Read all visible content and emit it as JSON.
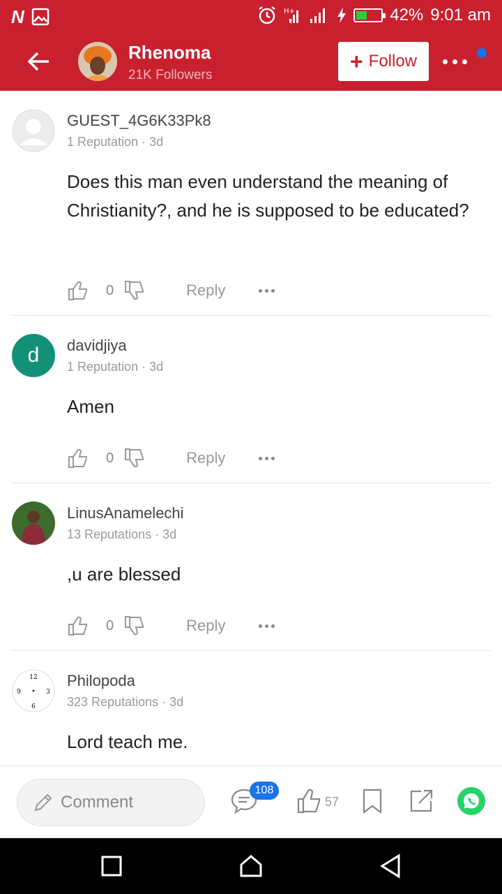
{
  "status_bar": {
    "battery_percent": "42%",
    "battery_level": 0.42,
    "time": "9:01 am",
    "icons": [
      "n-logo-icon",
      "image-icon",
      "alarm-icon",
      "signal-icon",
      "charging-icon",
      "battery-icon"
    ]
  },
  "header": {
    "name": "Rhenoma",
    "followers": "21K Followers",
    "follow_label": "Follow",
    "accent_color": "#c8202f"
  },
  "comments": [
    {
      "username": "GUEST_4G6K33Pk8",
      "meta": "1 Reputation · 3d",
      "text": "Does this man even understand the meaning of Christianity?, and he is supposed to be educated?",
      "likes": "0",
      "reply_label": "Reply",
      "avatar": "default-avatar-icon"
    },
    {
      "username": "davidjiya",
      "meta": "1 Reputation · 3d",
      "text": "Amen",
      "likes": "0",
      "reply_label": "Reply",
      "avatar_letter": "d",
      "avatar_color": "#139078"
    },
    {
      "username": "LinusAnamelechi",
      "meta": "13 Reputations · 3d",
      "text": ",u are blessed",
      "likes": "0",
      "reply_label": "Reply",
      "avatar": "photo-avatar"
    },
    {
      "username": "Philopoda",
      "meta": "323 Reputations · 3d",
      "text": "Lord teach me.",
      "likes": "",
      "reply_label": "",
      "avatar": "clock-avatar"
    }
  ],
  "bottom_bar": {
    "comment_placeholder": "Comment",
    "comment_count": "108",
    "like_count": "57",
    "icons": [
      "pencil-icon",
      "comment-icon",
      "like-icon",
      "bookmark-icon",
      "share-icon",
      "whatsapp-icon"
    ]
  },
  "nav_bar": {
    "icons": [
      "recents-icon",
      "home-icon",
      "back-icon"
    ]
  }
}
